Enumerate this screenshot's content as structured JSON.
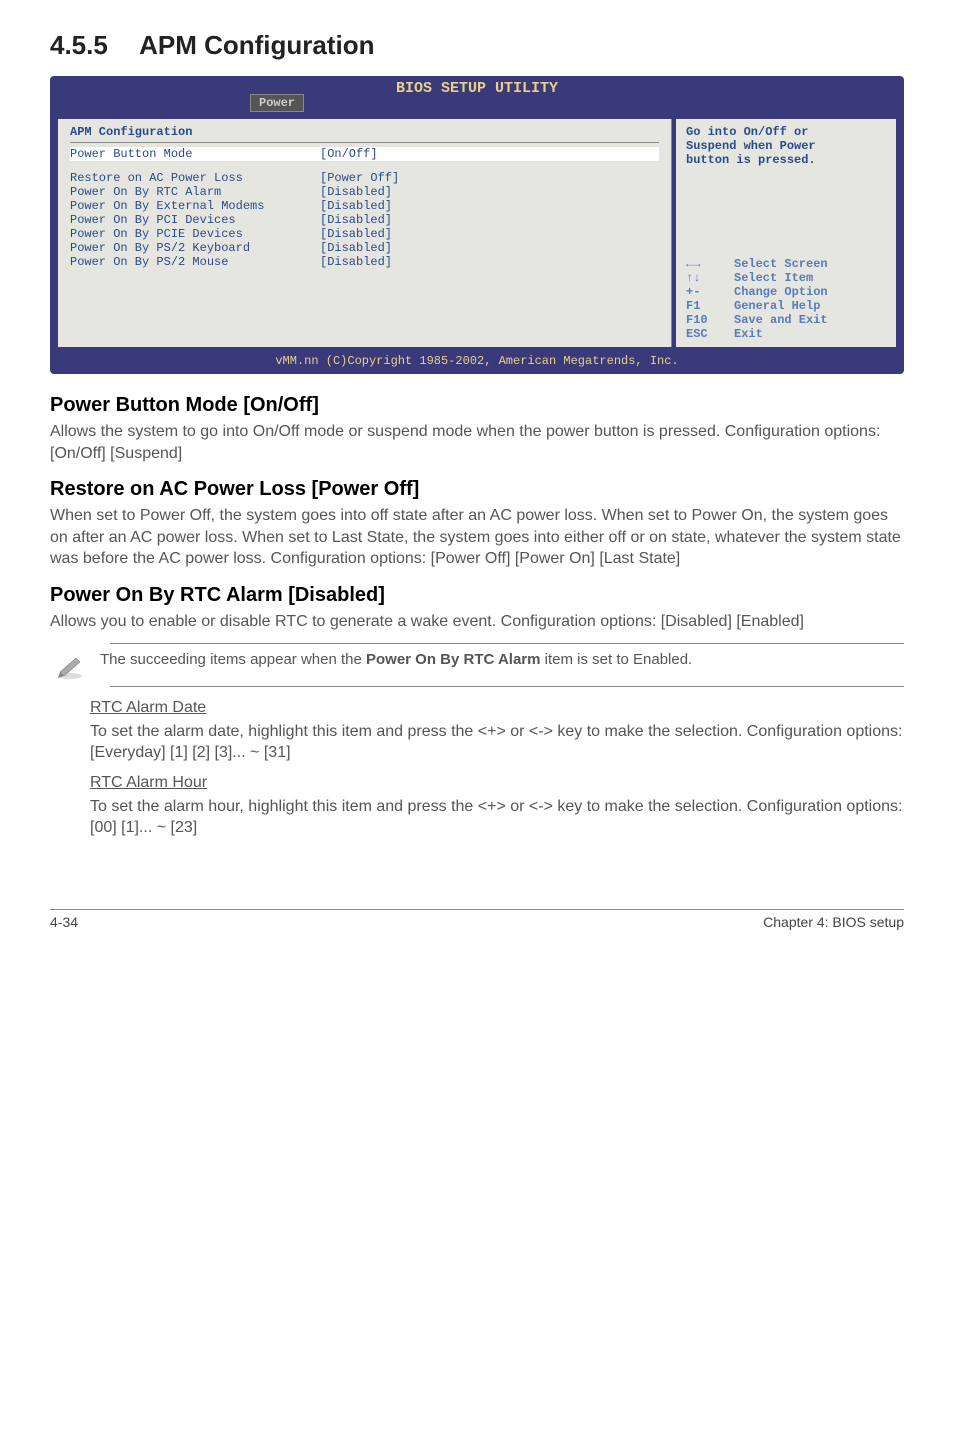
{
  "section": {
    "number": "4.5.5",
    "title": "APM Configuration"
  },
  "bios": {
    "header": "BIOS SETUP UTILITY",
    "tab": "Power",
    "cfg_title": "APM Configuration",
    "selected_label": "Power Button Mode",
    "selected_value": "[On/Off]",
    "rows": [
      {
        "label": "Restore on AC Power Loss",
        "value": "[Power Off]"
      },
      {
        "label": "Power On By RTC Alarm",
        "value": "[Disabled]"
      },
      {
        "label": "Power On By External Modems",
        "value": "[Disabled]"
      },
      {
        "label": "Power On By PCI Devices",
        "value": "[Disabled]"
      },
      {
        "label": "Power On By PCIE Devices",
        "value": "[Disabled]"
      },
      {
        "label": "Power On By PS/2 Keyboard",
        "value": "[Disabled]"
      },
      {
        "label": "Power On By PS/2 Mouse",
        "value": "[Disabled]"
      }
    ],
    "help1": "Go into On/Off or",
    "help2": "Suspend when Power",
    "help3": "button is pressed.",
    "nav": [
      {
        "key": "←→",
        "desc": "Select Screen"
      },
      {
        "key": "↑↓",
        "desc": "Select Item"
      },
      {
        "key": "+-",
        "desc": "Change Option"
      },
      {
        "key": "F1",
        "desc": "General Help"
      },
      {
        "key": "F10",
        "desc": "Save and Exit"
      },
      {
        "key": "ESC",
        "desc": "Exit"
      }
    ],
    "footer": "vMM.nn (C)Copyright 1985-2002, American Megatrends, Inc."
  },
  "sub1": {
    "heading": "Power Button Mode [On/Off]",
    "text": "Allows the system to go into On/Off mode or suspend mode when the power button is pressed. Configuration options: [On/Off] [Suspend]"
  },
  "sub2": {
    "heading": "Restore on AC Power Loss [Power Off]",
    "text": "When set to Power Off, the system goes into off state after an AC power loss. When set to Power On, the system goes on after an AC power loss. When set to Last State, the system goes into either off or on state, whatever the system state was before the AC power loss. Configuration options: [Power Off] [Power On] [Last State]"
  },
  "sub3": {
    "heading": "Power On By RTC Alarm [Disabled]",
    "text": "Allows you to enable or disable RTC to generate a wake event. Configuration options: [Disabled] [Enabled]"
  },
  "note": {
    "pre": "The succeeding items appear when the ",
    "bold": "Power On By RTC Alarm",
    "post": " item is set to Enabled."
  },
  "rtc_date": {
    "title": "RTC Alarm Date",
    "text": "To set the alarm date, highlight this item and press the <+> or <-> key to make the selection. Configuration options: [Everyday] [1] [2] [3]... ~ [31]"
  },
  "rtc_hour": {
    "title": "RTC Alarm Hour",
    "text": "To set the alarm hour, highlight this item and press the <+> or <-> key to make the selection. Configuration options: [00] [1]... ~ [23]"
  },
  "footer": {
    "left": "4-34",
    "right": "Chapter 4: BIOS setup"
  }
}
